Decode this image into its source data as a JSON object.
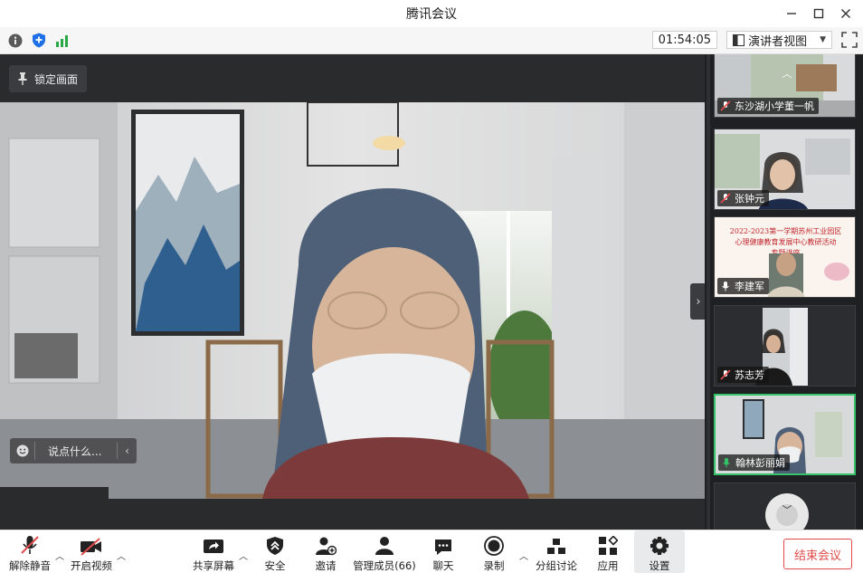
{
  "window": {
    "title": "腾讯会议"
  },
  "infobar": {
    "timer": "01:54:05",
    "view_mode": "演讲者视图"
  },
  "stage": {
    "lock_label": "锁定画面",
    "chat_placeholder": "说点什么..."
  },
  "participants": [
    {
      "name": "东沙湖小学董一帆",
      "mic": "muted"
    },
    {
      "name": "张钟元",
      "mic": "muted"
    },
    {
      "name": "李建军",
      "mic": "on",
      "slide_line1": "2022-2023第一学期苏州工业园区",
      "slide_line2": "心理健康教育发展中心教研活动",
      "slide_line3": "专题讲座"
    },
    {
      "name": "苏志芳",
      "mic": "muted"
    },
    {
      "name": "翰林彭丽娟",
      "mic": "speaking",
      "active": true
    }
  ],
  "toolbar": {
    "unmute": "解除静音",
    "start_video": "开启视频",
    "share_screen": "共享屏幕",
    "security": "安全",
    "invite": "邀请",
    "manage_members": "管理成员(66)",
    "chat": "聊天",
    "record": "录制",
    "breakout": "分组讨论",
    "apps": "应用",
    "settings": "设置",
    "end_meeting": "结束会议"
  },
  "colors": {
    "accent_green": "#35c46a",
    "end_red": "#e24a4a",
    "shield_blue": "#1f6fe6"
  }
}
